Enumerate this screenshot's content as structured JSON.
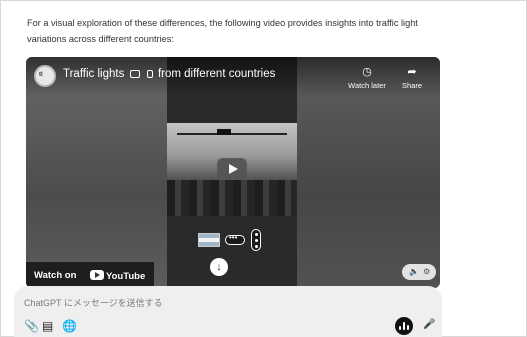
{
  "message": {
    "text": "For a visual exploration of these differences, the following video provides insights into traffic light variations across different countries:"
  },
  "video": {
    "title_before": "Traffic lights",
    "title_after": "from different countries",
    "watch_later_label": "Watch later",
    "share_label": "Share",
    "watch_on_label": "Watch on",
    "youtube_label": "YouTube"
  },
  "composer": {
    "placeholder": "ChatGPT にメッセージを送信する"
  },
  "icons": {
    "watch_later": "clock-icon",
    "share": "share-arrow-icon",
    "attach": "paperclip-icon",
    "tools": "tools-icon",
    "globe": "globe-icon",
    "voice": "voice-mode-icon",
    "mic": "microphone-icon"
  },
  "colors": {
    "page_bg": "#ffffff",
    "composer_bg": "#efefef",
    "voice_button": "#111111"
  }
}
